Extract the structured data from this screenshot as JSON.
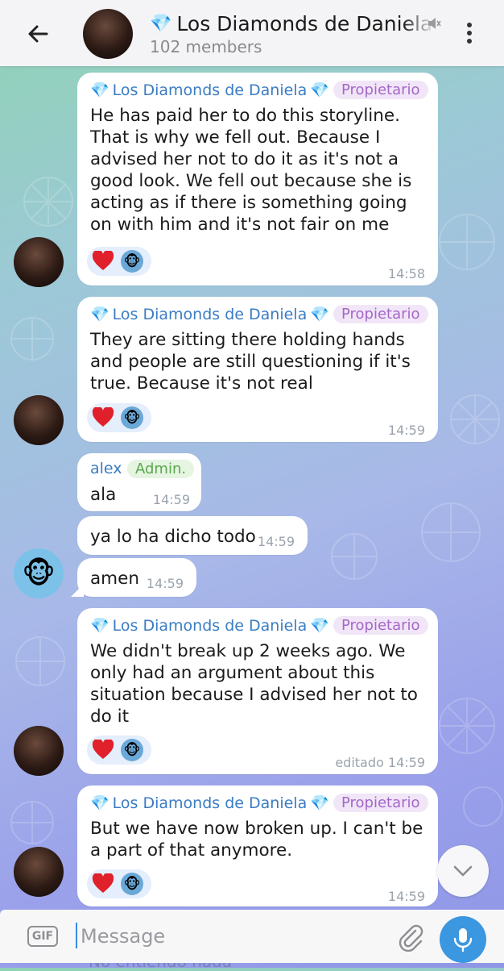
{
  "header": {
    "title": "Los Diamonds de Daniela",
    "title_gem": "💎",
    "subtitle": "102 members"
  },
  "messages": [
    {
      "sender": "Los Diamonds de Daniela",
      "role": "Propietario",
      "text": "He has paid her to do this storyline. That is why we fell out. Because I advised her not to do it as it's not a good look. We fell out because she is acting as if there is something going on with him and it's not fair on me",
      "time": "14:58",
      "reactions": [
        "heart",
        "monkey"
      ]
    },
    {
      "sender": "Los Diamonds de Daniela",
      "role": "Propietario",
      "text": "They are sitting there holding hands and people are still questioning if it's true. Because it's not real",
      "time": "14:59",
      "reactions": [
        "heart",
        "monkey"
      ]
    },
    {
      "sender": "alex",
      "role": "Admin.",
      "text": "ala",
      "time": "14:59"
    },
    {
      "text": "ya lo ha dicho todo",
      "time": "14:59"
    },
    {
      "text": "amen",
      "time": "14:59"
    },
    {
      "sender": "Los Diamonds de Daniela",
      "role": "Propietario",
      "text": "We didn't break up 2 weeks ago. We only had an argument about this situation because I advised her not to do it",
      "time": "editado 14:59",
      "reactions": [
        "heart",
        "monkey"
      ]
    },
    {
      "sender": "Los Diamonds de Daniela",
      "role": "Propietario",
      "text": "But we have now broken up. I can't be a part of that anymore.",
      "time": "14:59",
      "reactions": [
        "heart",
        "monkey"
      ]
    }
  ],
  "partially_hidden_message": "No entiendo nada",
  "composer": {
    "gif_label": "GIF",
    "placeholder": "Message"
  },
  "colors": {
    "sender_name": "#3a7cc4",
    "owner_badge": "#a567c9",
    "admin_badge": "#5aa84e",
    "accent_blue": "#3b97e0",
    "heart": "#e0202a"
  }
}
